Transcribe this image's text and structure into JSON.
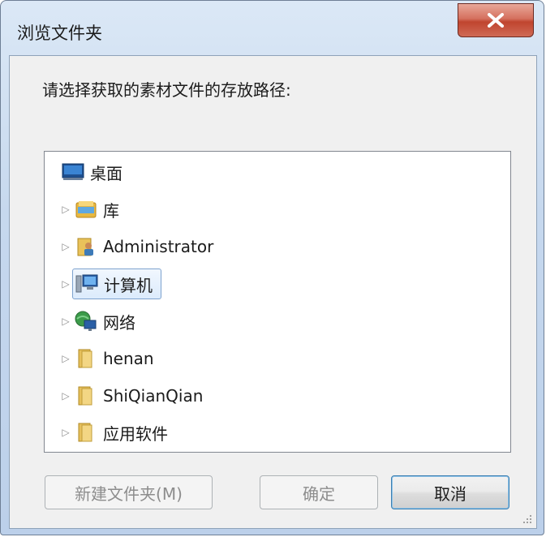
{
  "window": {
    "title": "浏览文件夹"
  },
  "dialog": {
    "prompt": "请选择获取的素材文件的存放路径:"
  },
  "tree": {
    "items": [
      {
        "label": "桌面",
        "icon": "desktop-icon",
        "expandable": false,
        "selected": false
      },
      {
        "label": "库",
        "icon": "library-icon",
        "expandable": true,
        "selected": false
      },
      {
        "label": "Administrator",
        "icon": "user-folder-icon",
        "expandable": true,
        "selected": false
      },
      {
        "label": "计算机",
        "icon": "computer-icon",
        "expandable": true,
        "selected": true
      },
      {
        "label": "网络",
        "icon": "network-icon",
        "expandable": true,
        "selected": false
      },
      {
        "label": "henan",
        "icon": "folder-icon",
        "expandable": true,
        "selected": false
      },
      {
        "label": "ShiQianQian",
        "icon": "folder-icon",
        "expandable": true,
        "selected": false
      },
      {
        "label": "应用软件",
        "icon": "folder-icon",
        "expandable": true,
        "selected": false
      }
    ]
  },
  "buttons": {
    "new_folder": "新建文件夹(M)",
    "ok": "确定",
    "cancel": "取消"
  },
  "colors": {
    "selection_border": "#7da2ce",
    "close_button": "#c0452f",
    "frame": "#c6d8ee"
  }
}
